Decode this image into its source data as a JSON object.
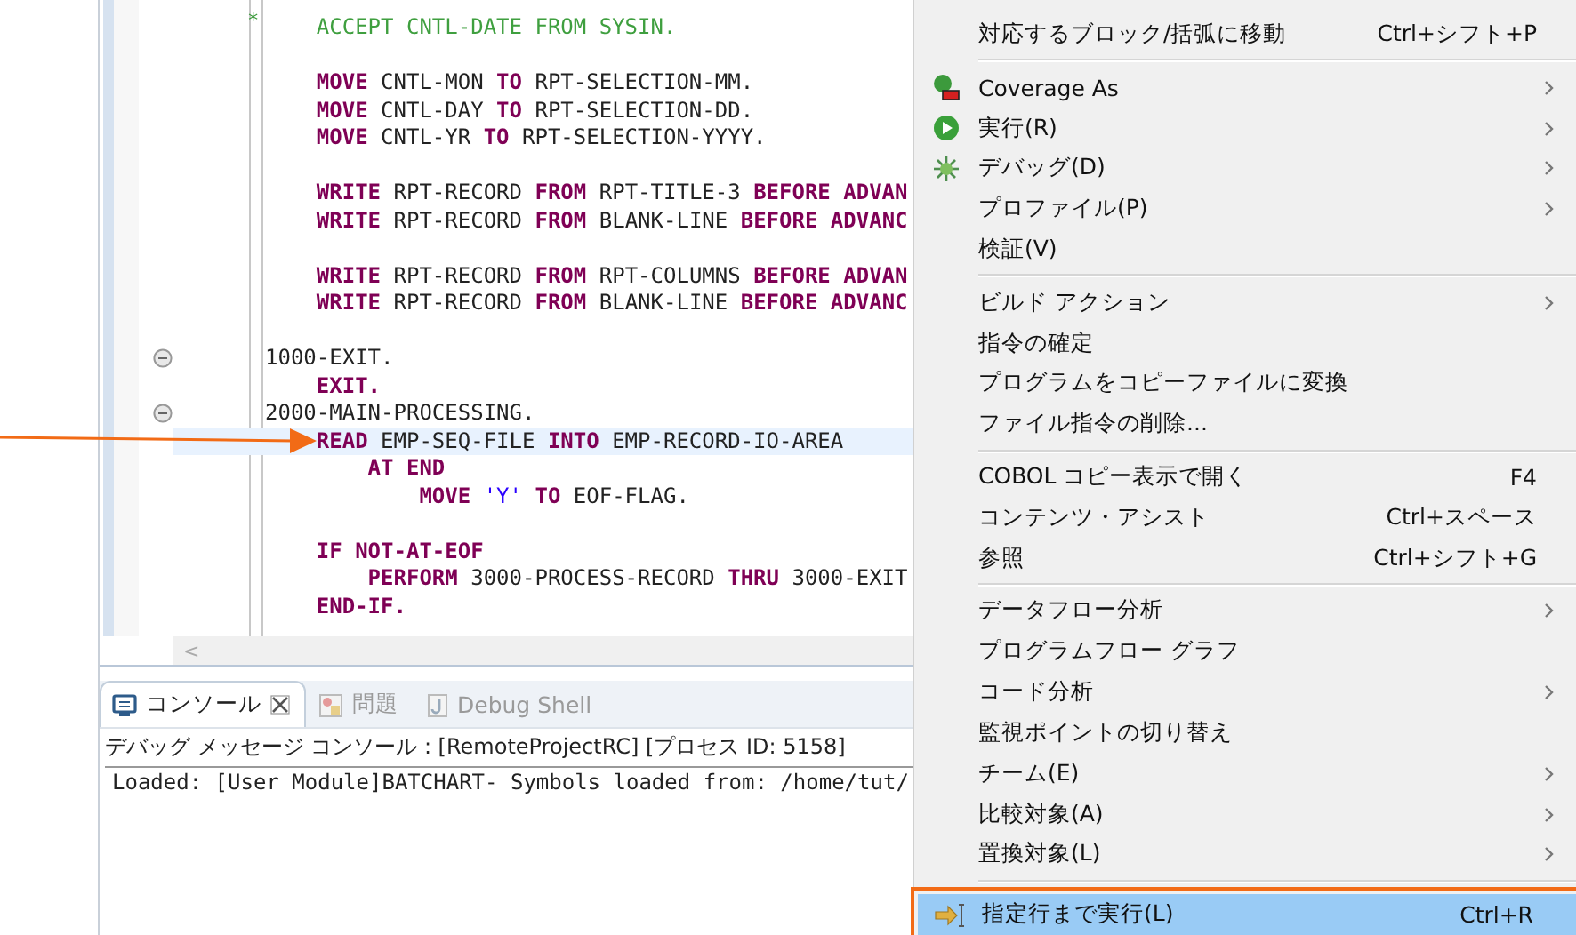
{
  "editor": {
    "lines": [
      {
        "kind": "comment",
        "indicator": "*",
        "tokens": [
          {
            "kind": "comment",
            "text": "    ACCEPT CNTL-DATE FROM SYSIN."
          }
        ]
      },
      {
        "kind": "blank"
      },
      {
        "kind": "code",
        "tokens": [
          {
            "kind": "keyword",
            "text": "    MOVE"
          },
          {
            "kind": "plain",
            "text": " CNTL-MON "
          },
          {
            "kind": "keyword",
            "text": "TO"
          },
          {
            "kind": "plain",
            "text": " RPT-SELECTION-MM."
          }
        ]
      },
      {
        "kind": "code",
        "tokens": [
          {
            "kind": "keyword",
            "text": "    MOVE"
          },
          {
            "kind": "plain",
            "text": " CNTL-DAY "
          },
          {
            "kind": "keyword",
            "text": "TO"
          },
          {
            "kind": "plain",
            "text": " RPT-SELECTION-DD."
          }
        ]
      },
      {
        "kind": "code",
        "tokens": [
          {
            "kind": "keyword",
            "text": "    MOVE"
          },
          {
            "kind": "plain",
            "text": " CNTL-YR "
          },
          {
            "kind": "keyword",
            "text": "TO"
          },
          {
            "kind": "plain",
            "text": " RPT-SELECTION-YYYY."
          }
        ]
      },
      {
        "kind": "blank"
      },
      {
        "kind": "code",
        "tokens": [
          {
            "kind": "keyword",
            "text": "    WRITE"
          },
          {
            "kind": "plain",
            "text": " RPT-RECORD "
          },
          {
            "kind": "keyword",
            "text": "FROM"
          },
          {
            "kind": "plain",
            "text": " RPT-TITLE-3 "
          },
          {
            "kind": "keyword",
            "text": "BEFORE ADVAN"
          }
        ]
      },
      {
        "kind": "code",
        "tokens": [
          {
            "kind": "keyword",
            "text": "    WRITE"
          },
          {
            "kind": "plain",
            "text": " RPT-RECORD "
          },
          {
            "kind": "keyword",
            "text": "FROM"
          },
          {
            "kind": "plain",
            "text": " BLANK-LINE "
          },
          {
            "kind": "keyword",
            "text": "BEFORE ADVANC"
          }
        ]
      },
      {
        "kind": "blank"
      },
      {
        "kind": "code",
        "tokens": [
          {
            "kind": "keyword",
            "text": "    WRITE"
          },
          {
            "kind": "plain",
            "text": " RPT-RECORD "
          },
          {
            "kind": "keyword",
            "text": "FROM"
          },
          {
            "kind": "plain",
            "text": " RPT-COLUMNS "
          },
          {
            "kind": "keyword",
            "text": "BEFORE ADVAN"
          }
        ]
      },
      {
        "kind": "code",
        "tokens": [
          {
            "kind": "keyword",
            "text": "    WRITE"
          },
          {
            "kind": "plain",
            "text": " RPT-RECORD "
          },
          {
            "kind": "keyword",
            "text": "FROM"
          },
          {
            "kind": "plain",
            "text": " BLANK-LINE "
          },
          {
            "kind": "keyword",
            "text": "BEFORE ADVANC"
          }
        ]
      },
      {
        "kind": "blank"
      },
      {
        "kind": "code",
        "expanded": true,
        "tokens": [
          {
            "kind": "plain",
            "text": "1000-EXIT."
          }
        ]
      },
      {
        "kind": "code",
        "tokens": [
          {
            "kind": "keyword",
            "text": "    EXIT."
          }
        ]
      },
      {
        "kind": "code",
        "expanded": true,
        "tokens": [
          {
            "kind": "plain",
            "text": "2000-MAIN-PROCESSING."
          }
        ]
      },
      {
        "kind": "code",
        "current": true,
        "tokens": [
          {
            "kind": "keyword",
            "text": "    READ"
          },
          {
            "kind": "plain",
            "text": " EMP-SEQ-FILE "
          },
          {
            "kind": "keyword",
            "text": "INTO"
          },
          {
            "kind": "plain",
            "text": " EMP-RECORD-IO-AREA"
          }
        ]
      },
      {
        "kind": "code",
        "tokens": [
          {
            "kind": "keyword",
            "text": "        AT END"
          }
        ]
      },
      {
        "kind": "code",
        "tokens": [
          {
            "kind": "keyword",
            "text": "            MOVE"
          },
          {
            "kind": "string",
            "text": " 'Y'"
          },
          {
            "kind": "keyword",
            "text": " TO"
          },
          {
            "kind": "plain",
            "text": " EOF-FLAG."
          }
        ]
      },
      {
        "kind": "blank"
      },
      {
        "kind": "code",
        "tokens": [
          {
            "kind": "keyword",
            "text": "    IF NOT-AT-EOF"
          }
        ]
      },
      {
        "kind": "code",
        "tokens": [
          {
            "kind": "keyword",
            "text": "        PERFORM"
          },
          {
            "kind": "plain",
            "text": " 3000-PROCESS-RECORD "
          },
          {
            "kind": "keyword",
            "text": "THRU"
          },
          {
            "kind": "plain",
            "text": " 3000-EXIT"
          }
        ]
      },
      {
        "kind": "code",
        "tokens": [
          {
            "kind": "keyword",
            "text": "    END-IF."
          }
        ]
      }
    ],
    "scroll_left": "<"
  },
  "console": {
    "tabs": [
      {
        "label": "コンソール",
        "selected": true,
        "closable": true,
        "disabled": false
      },
      {
        "label": "問題",
        "selected": false,
        "closable": false,
        "disabled": true
      },
      {
        "label": "Debug Shell",
        "selected": false,
        "closable": false,
        "disabled": true
      }
    ],
    "header": "デバッグ メッセージ コンソール : [RemoteProjectRC] [プロセス ID: 5158]",
    "output": [
      "Loaded: [User Module]BATCHART- Symbols loaded from: /home/tut/"
    ]
  },
  "context_menu": {
    "items": [
      {
        "kind": "item",
        "label": "対応するブロック/括弧に移動",
        "shortcut": "Ctrl+シフト+P",
        "submenu": false,
        "selected": false
      },
      {
        "kind": "separator"
      },
      {
        "kind": "item",
        "label": "Coverage As",
        "submenu": true,
        "selected": false
      },
      {
        "kind": "item",
        "label": "実行(R)",
        "submenu": true,
        "selected": false
      },
      {
        "kind": "item",
        "label": "デバッグ(D)",
        "submenu": true,
        "selected": false
      },
      {
        "kind": "item",
        "label": "プロファイル(P)",
        "submenu": true,
        "selected": false
      },
      {
        "kind": "item",
        "label": "検証(V)",
        "submenu": false,
        "selected": false
      },
      {
        "kind": "separator"
      },
      {
        "kind": "item",
        "label": "ビルド アクション",
        "submenu": true,
        "selected": false
      },
      {
        "kind": "item",
        "label": "指令の確定",
        "submenu": false,
        "selected": false
      },
      {
        "kind": "item",
        "label": "プログラムをコピーファイルに変換",
        "submenu": false,
        "selected": false
      },
      {
        "kind": "item",
        "label": "ファイル指令の削除...",
        "submenu": false,
        "selected": false
      },
      {
        "kind": "separator"
      },
      {
        "kind": "item",
        "label": "COBOL コピー表示で開く",
        "shortcut": "F4",
        "submenu": false,
        "selected": false
      },
      {
        "kind": "item",
        "label": "コンテンツ・アシスト",
        "shortcut": "Ctrl+スペース",
        "submenu": false,
        "selected": false
      },
      {
        "kind": "item",
        "label": "参照",
        "shortcut": "Ctrl+シフト+G",
        "submenu": false,
        "selected": false
      },
      {
        "kind": "separator"
      },
      {
        "kind": "item",
        "label": "データフロー分析",
        "submenu": true,
        "selected": false
      },
      {
        "kind": "item",
        "label": "プログラムフロー グラフ",
        "submenu": false,
        "selected": false
      },
      {
        "kind": "item",
        "label": "コード分析",
        "submenu": true,
        "selected": false
      },
      {
        "kind": "item",
        "label": "監視ポイントの切り替え",
        "submenu": false,
        "selected": false
      },
      {
        "kind": "item",
        "label": "チーム(E)",
        "submenu": true,
        "selected": false
      },
      {
        "kind": "item",
        "label": "比較対象(A)",
        "submenu": true,
        "selected": false
      },
      {
        "kind": "item",
        "label": "置換対象(L)",
        "submenu": true,
        "selected": false
      },
      {
        "kind": "separator"
      },
      {
        "kind": "item",
        "label": "指定行まで実行(L)",
        "shortcut": "Ctrl+R",
        "submenu": false,
        "selected": true
      }
    ]
  }
}
